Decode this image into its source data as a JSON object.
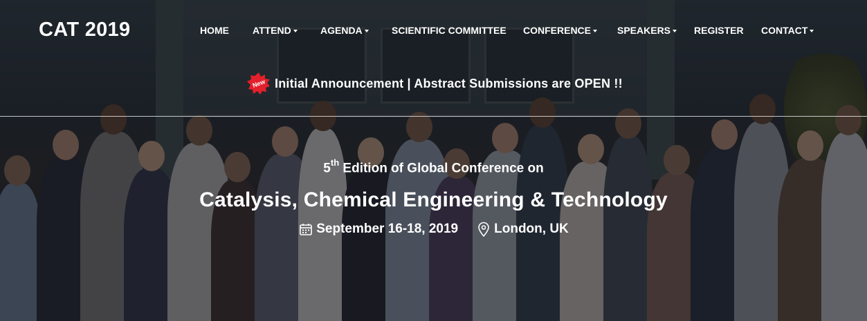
{
  "brand": {
    "logo": "CAT 2019"
  },
  "nav": {
    "items": [
      {
        "label": "HOME",
        "dropdown": false
      },
      {
        "label": "ATTEND",
        "dropdown": true
      },
      {
        "label": "AGENDA",
        "dropdown": true
      },
      {
        "label": "SCIENTIFIC COMMITTEE",
        "dropdown": false
      },
      {
        "label": "CONFERENCE",
        "dropdown": true
      },
      {
        "label": "SPEAKERS",
        "dropdown": true
      },
      {
        "label": "REGISTER",
        "dropdown": false
      },
      {
        "label": "CONTACT",
        "dropdown": true
      }
    ]
  },
  "announcement": {
    "badge": "New",
    "badge_icon": "new-starburst-icon",
    "text": "Initial Announcement | Abstract Submissions are OPEN !!"
  },
  "hero": {
    "edition_number": "5",
    "edition_suffix": "th",
    "edition_text": " Edition of Global Conference on",
    "title": "Catalysis, Chemical Engineering & Technology",
    "date_icon": "calendar-icon",
    "date": "September 16-18, 2019",
    "location_icon": "map-pin-icon",
    "location": "London, UK"
  },
  "colors": {
    "text": "#ffffff",
    "badge_red": "#e3202b",
    "overlay": "rgba(10,10,14,0.55)"
  }
}
